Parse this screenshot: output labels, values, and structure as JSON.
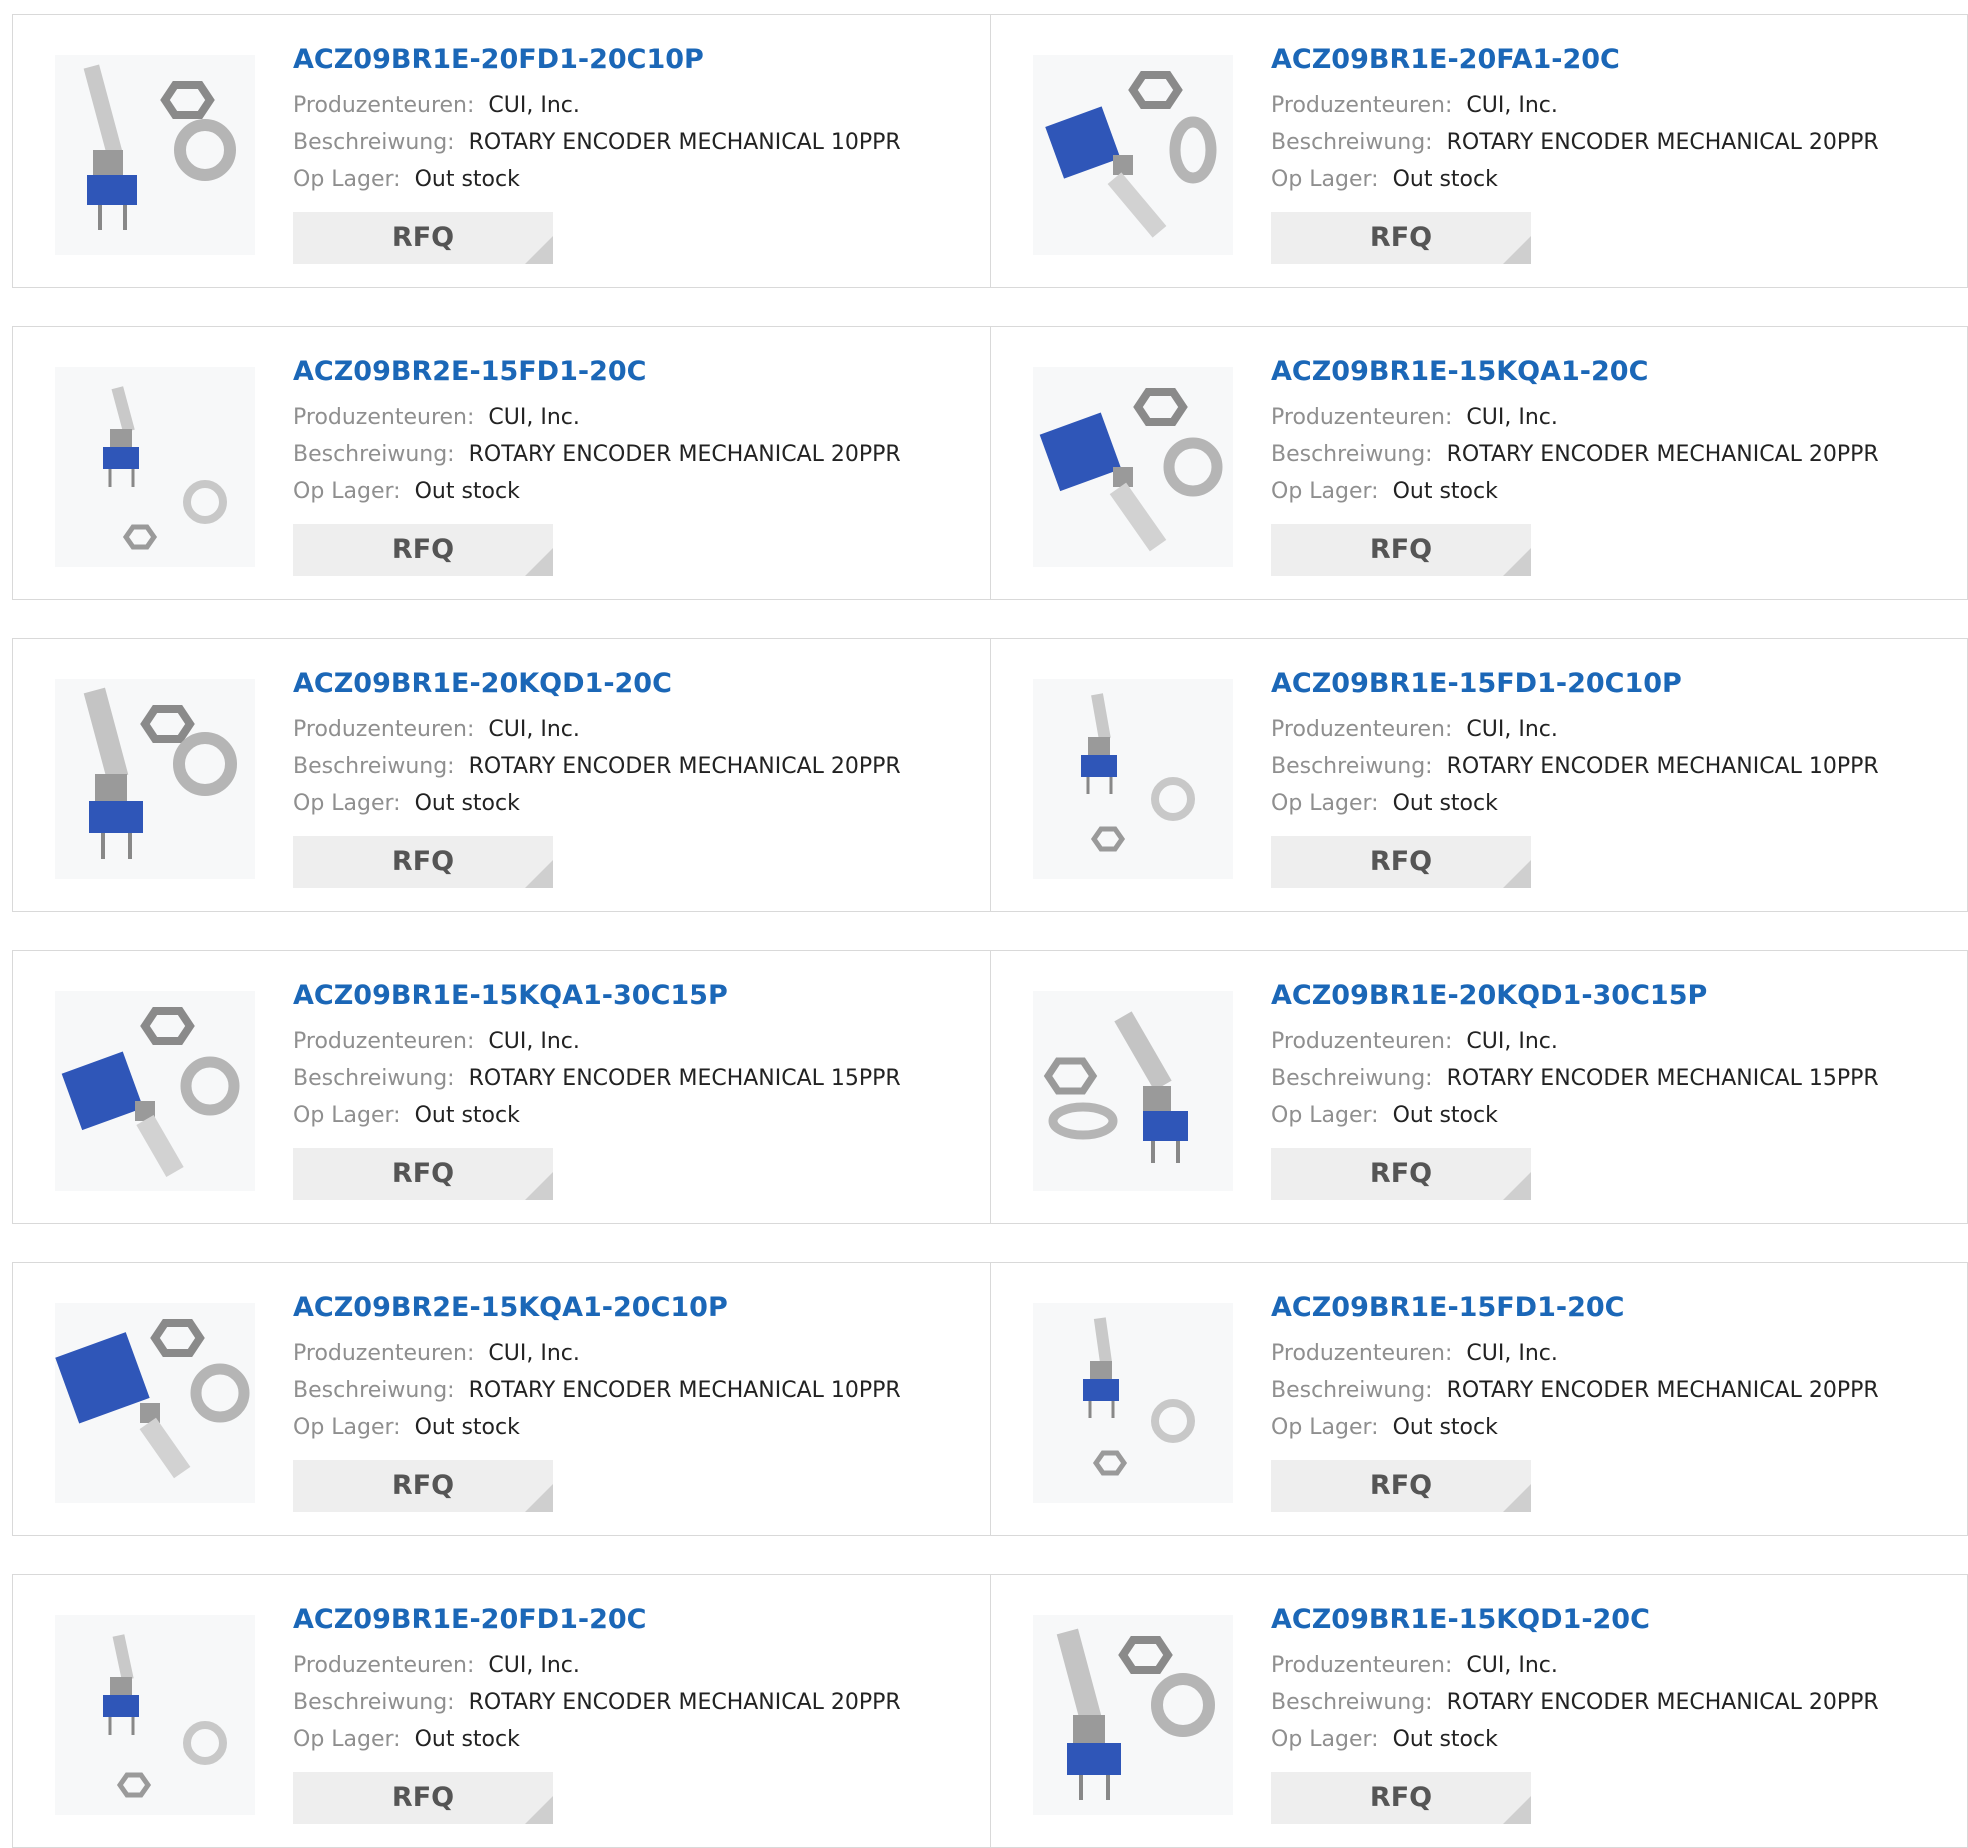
{
  "labels": {
    "manufacturer": "Produzenteuren:",
    "description": "Beschreiwung:",
    "stock": "Op Lager:",
    "rfq": "RFQ"
  },
  "products": [
    {
      "part": "ACZ09BR1E-20FD1-20C10P",
      "manufacturer": "CUI, Inc.",
      "description": "ROTARY ENCODER MECHANICAL 10PPR",
      "stock": "Out stock"
    },
    {
      "part": "ACZ09BR1E-20FA1-20C",
      "manufacturer": "CUI, Inc.",
      "description": "ROTARY ENCODER MECHANICAL 20PPR",
      "stock": "Out stock"
    },
    {
      "part": "ACZ09BR2E-15FD1-20C",
      "manufacturer": "CUI, Inc.",
      "description": "ROTARY ENCODER MECHANICAL 20PPR",
      "stock": "Out stock"
    },
    {
      "part": "ACZ09BR1E-15KQA1-20C",
      "manufacturer": "CUI, Inc.",
      "description": "ROTARY ENCODER MECHANICAL 20PPR",
      "stock": "Out stock"
    },
    {
      "part": "ACZ09BR1E-20KQD1-20C",
      "manufacturer": "CUI, Inc.",
      "description": "ROTARY ENCODER MECHANICAL 20PPR",
      "stock": "Out stock"
    },
    {
      "part": "ACZ09BR1E-15FD1-20C10P",
      "manufacturer": "CUI, Inc.",
      "description": "ROTARY ENCODER MECHANICAL 10PPR",
      "stock": "Out stock"
    },
    {
      "part": "ACZ09BR1E-15KQA1-30C15P",
      "manufacturer": "CUI, Inc.",
      "description": "ROTARY ENCODER MECHANICAL 15PPR",
      "stock": "Out stock"
    },
    {
      "part": "ACZ09BR1E-20KQD1-30C15P",
      "manufacturer": "CUI, Inc.",
      "description": "ROTARY ENCODER MECHANICAL 15PPR",
      "stock": "Out stock"
    },
    {
      "part": "ACZ09BR2E-15KQA1-20C10P",
      "manufacturer": "CUI, Inc.",
      "description": "ROTARY ENCODER MECHANICAL 10PPR",
      "stock": "Out stock"
    },
    {
      "part": "ACZ09BR1E-15FD1-20C",
      "manufacturer": "CUI, Inc.",
      "description": "ROTARY ENCODER MECHANICAL 20PPR",
      "stock": "Out stock"
    },
    {
      "part": "ACZ09BR1E-20FD1-20C",
      "manufacturer": "CUI, Inc.",
      "description": "ROTARY ENCODER MECHANICAL 20PPR",
      "stock": "Out stock"
    },
    {
      "part": "ACZ09BR1E-15KQD1-20C",
      "manufacturer": "CUI, Inc.",
      "description": "ROTARY ENCODER MECHANICAL 20PPR",
      "stock": "Out stock"
    }
  ],
  "colors": {
    "title": "#1b67b7",
    "label": "#8f8f8f",
    "border": "#d9d9d9",
    "rfq_bg": "#eeeeee",
    "encoder_body": "#2f56b8"
  }
}
